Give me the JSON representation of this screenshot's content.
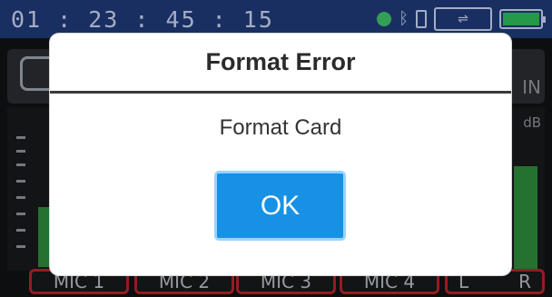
{
  "status_bar": {
    "time": "01 : 23 : 45 : 15",
    "icons": [
      "record-dot-icon",
      "bluetooth-icon",
      "sd-card-icon",
      "usb-icon",
      "battery-icon"
    ]
  },
  "background": {
    "right_label": "IN",
    "db_label": "dB",
    "channels": [
      "MIC 1",
      "MIC 2",
      "MIC 3",
      "MIC 4"
    ],
    "lr": {
      "left": "L",
      "right": "R"
    }
  },
  "dialog": {
    "title": "Format Error",
    "message": "Format Card",
    "ok_label": "OK"
  },
  "colors": {
    "status_bar": "#1f3a78",
    "ok_button": "#1791e6",
    "channel_border": "#b3242a",
    "meter": "#2e8a3a",
    "battery": "#2dbb59"
  }
}
